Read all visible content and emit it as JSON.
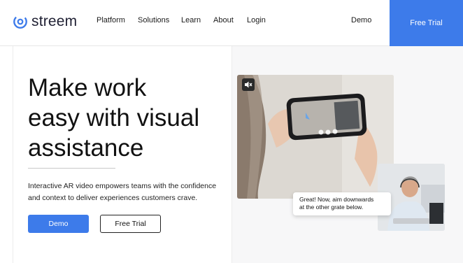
{
  "brand": {
    "name": "streem",
    "accent": "#3d7bea"
  },
  "nav": {
    "items": [
      {
        "label": "Platform"
      },
      {
        "label": "Solutions"
      },
      {
        "label": "Learn"
      },
      {
        "label": "About"
      },
      {
        "label": "Login"
      }
    ],
    "demo_label": "Demo",
    "trial_label": "Free Trial"
  },
  "hero": {
    "headline_lines": [
      "Make work",
      "easy with visual",
      "assistance"
    ],
    "subtext_lines": [
      "Interactive AR video empowers teams with the confidence",
      "and context to deliver experiences customers crave."
    ],
    "demo_button": "Demo",
    "trial_button": "Free Trial"
  },
  "media": {
    "mute_icon": "mute-icon",
    "chat_bubble_lines": [
      "Great! Now, aim downwards",
      "at the other grate below."
    ]
  }
}
